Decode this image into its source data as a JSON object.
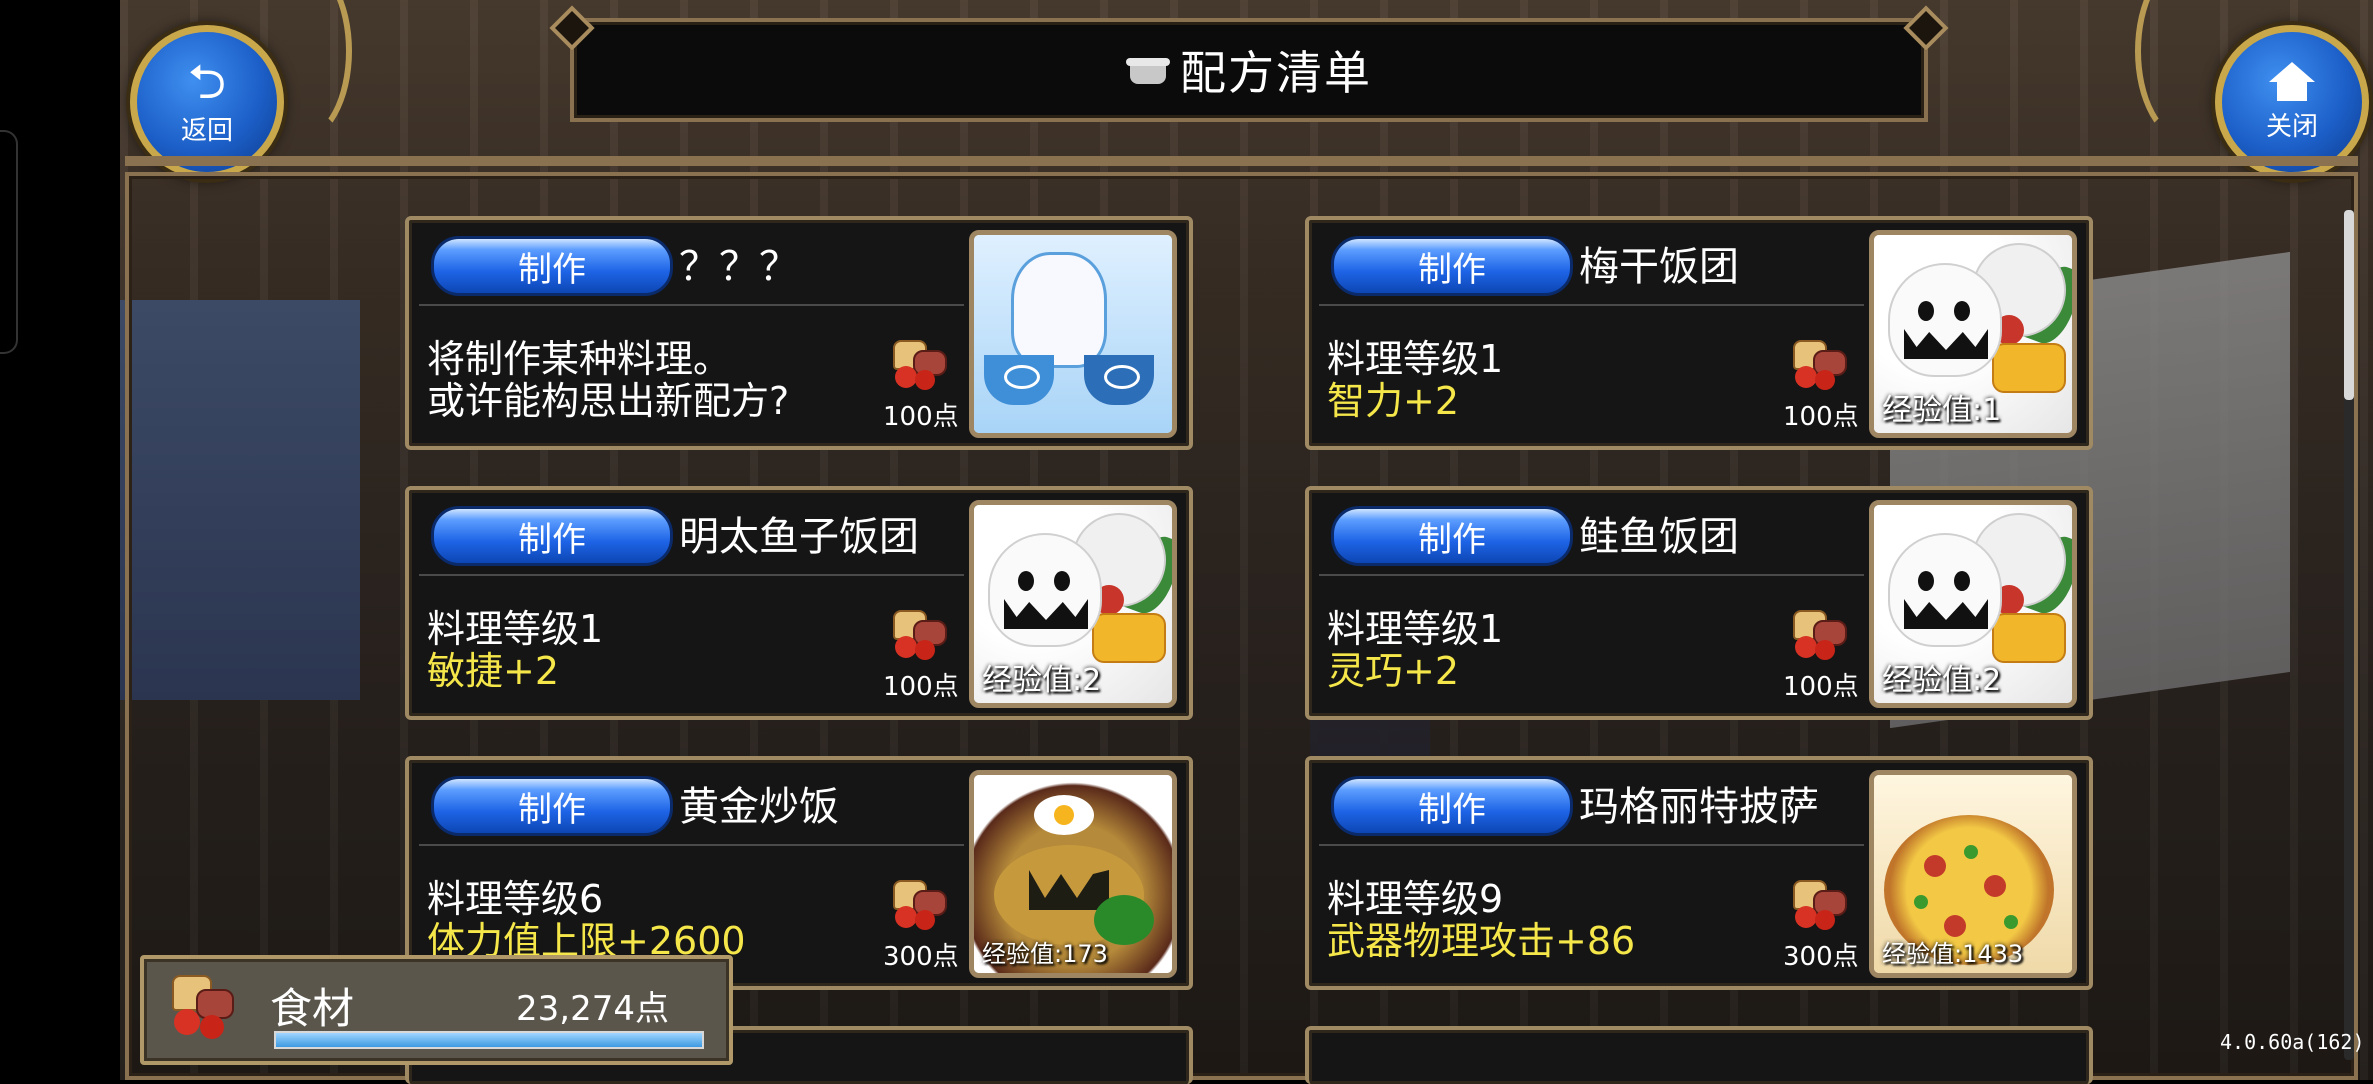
{
  "title": "配方清单",
  "back_label": "返回",
  "close_label": "关闭",
  "make_label": "制作",
  "cards": [
    {
      "name": "？？？",
      "line1": "将制作某种料理。",
      "line2": "或许能构思出新配方?",
      "cost": "100点",
      "exp": "",
      "art": "teapot"
    },
    {
      "name": "梅干饭团",
      "line1": "料理等级1",
      "line2": "智力+2",
      "cost": "100点",
      "exp": "经验值:1",
      "art": "onigiri"
    },
    {
      "name": "明太鱼子饭团",
      "line1": "料理等级1",
      "line2": "敏捷+2",
      "cost": "100点",
      "exp": "经验值:2",
      "art": "onigiri"
    },
    {
      "name": "鲑鱼饭团",
      "line1": "料理等级1",
      "line2": "灵巧+2",
      "cost": "100点",
      "exp": "经验值:2",
      "art": "onigiri"
    },
    {
      "name": "黄金炒饭",
      "line1": "料理等级6",
      "line2": "体力值上限+2600",
      "cost": "300点",
      "exp": "经验值:173",
      "art": "rice"
    },
    {
      "name": "玛格丽特披萨",
      "line1": "料理等级9",
      "line2": "武器物理攻击+86",
      "cost": "300点",
      "exp": "经验值:1433",
      "art": "pizza"
    }
  ],
  "ingredients": {
    "label": "食材",
    "value": "23,274点",
    "fill_fraction": 1.0
  },
  "version": "4.0.60a(162)",
  "colors": {
    "accent_blue": "#1e64e6",
    "stat_yellow": "#f5e64a",
    "frame_gold": "#a08a64"
  }
}
